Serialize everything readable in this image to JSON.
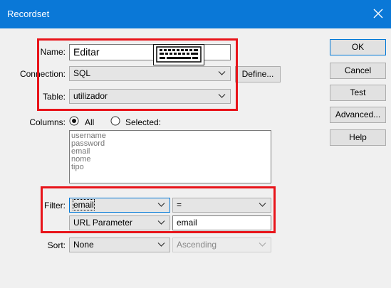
{
  "window": {
    "title": "Recordset"
  },
  "name": {
    "label": "Name:",
    "value": "Editar"
  },
  "connection": {
    "label": "Connection:",
    "value": "SQL",
    "define_label": "Define..."
  },
  "table": {
    "label": "Table:",
    "value": "utilizador"
  },
  "columns": {
    "label": "Columns:",
    "all_label": "All",
    "selected_label": "Selected:",
    "selected_option": "All",
    "items": [
      "username",
      "password",
      "email",
      "nome",
      "tipo"
    ]
  },
  "filter": {
    "label": "Filter:",
    "column": "email",
    "operator": "=",
    "source": "URL Parameter",
    "value": "email"
  },
  "sort": {
    "label": "Sort:",
    "column": "None",
    "direction": "Ascending"
  },
  "buttons": {
    "ok": "OK",
    "cancel": "Cancel",
    "test": "Test",
    "advanced": "Advanced...",
    "help": "Help"
  },
  "colors": {
    "titlebar": "#0a78d7",
    "highlight": "#e8141a",
    "focus": "#0078d7"
  },
  "icons": [
    "close-icon",
    "chevron-down-icon",
    "keyboard-icon",
    "radio-checked-icon",
    "radio-unchecked-icon"
  ]
}
